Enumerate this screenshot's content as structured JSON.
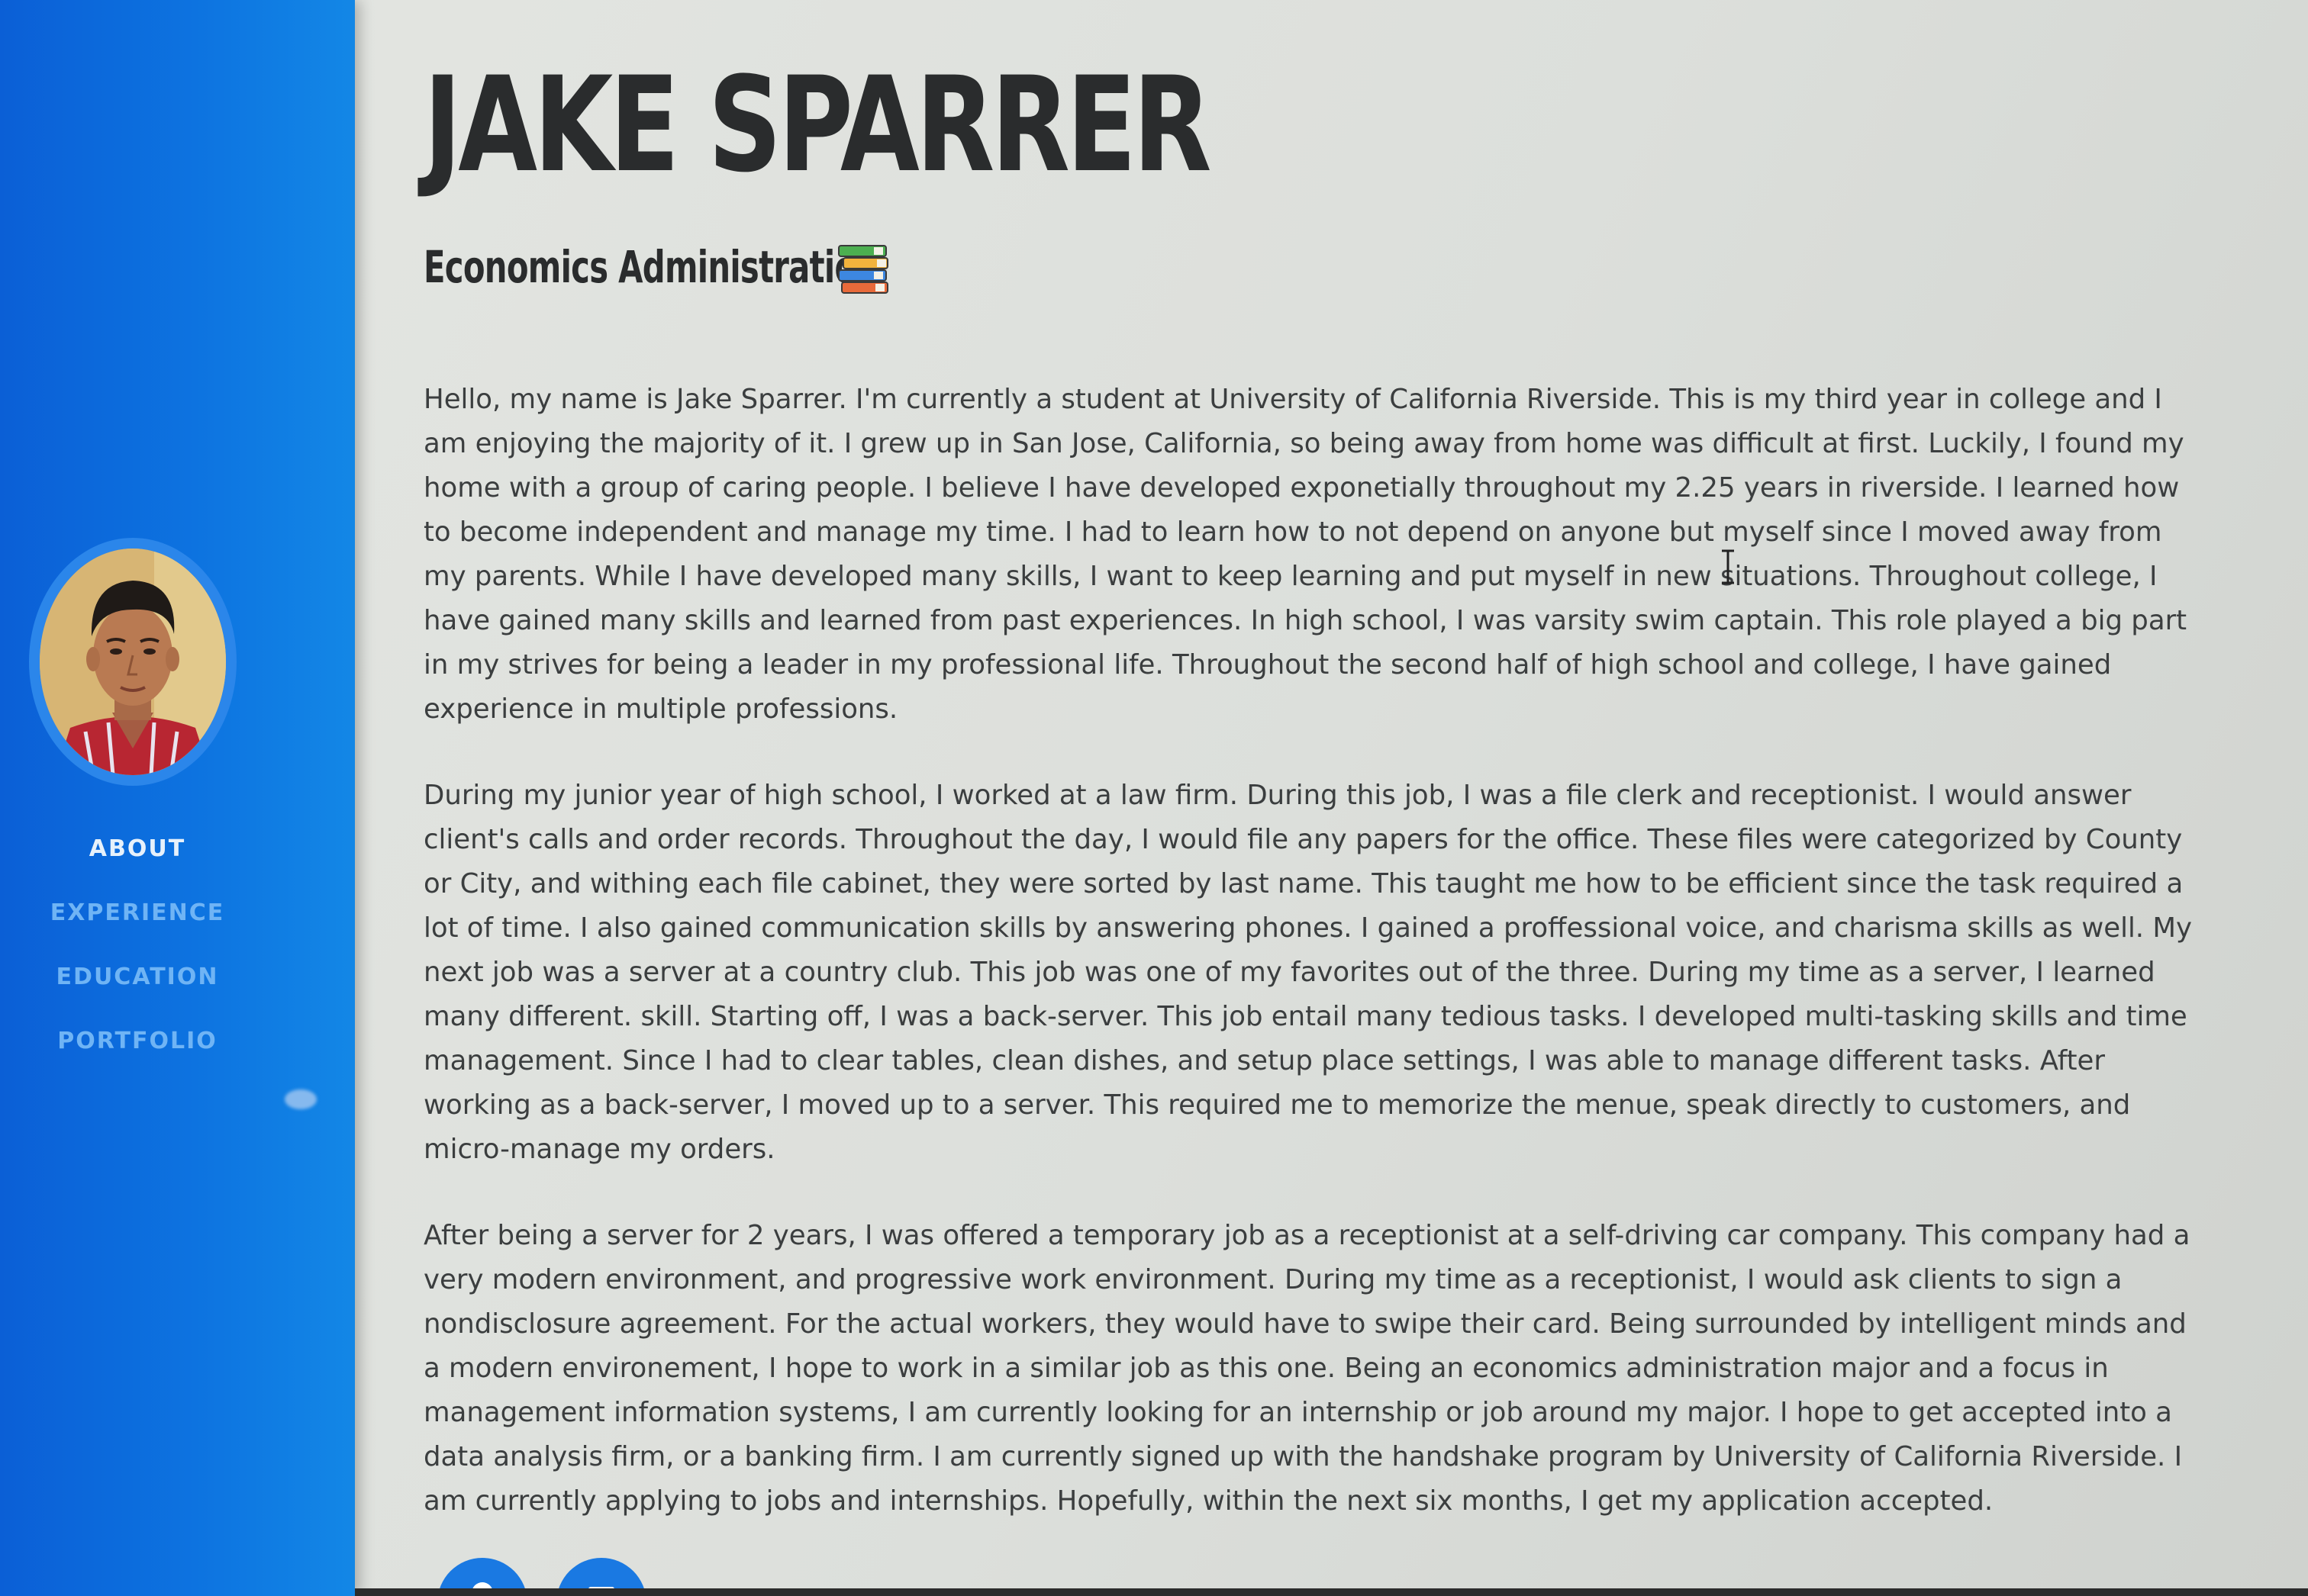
{
  "sidebar": {
    "avatar_alt": "Profile photo",
    "nav": [
      "ABOUT",
      "EXPERIENCE",
      "EDUCATION",
      "PORTFOLIO"
    ],
    "active_item": "ABOUT"
  },
  "header": {
    "name": "JAKE SPARRER",
    "subtitle": "Economics Administration",
    "subtitle_icon": "books-icon"
  },
  "about": {
    "paragraphs": [
      "Hello, my name is Jake Sparrer. I'm currently a student at University of California Riverside. This is my third year in college and I am enjoying the majority of it. I grew up in San Jose, California, so being away from home was difficult at first. Luckily, I found my home with a group of caring people. I believe I have developed exponetially throughout my 2.25 years in riverside. I learned how to become independent and manage my time. I had to learn how to not depend on anyone but myself since I moved away from my parents. While I have developed many skills, I want to keep learning and put myself in new situations. Throughout college, I have gained many skills and learned from past experiences. In high school, I was varsity swim captain. This role played a big part in my strives for being a leader in my professional life. Throughout the second half of high school and college, I have gained experience in multiple professions.",
      "During my junior year of high school, I worked at a law firm. During this job, I was a file clerk and receptionist. I would answer client's calls and order records. Throughout the day, I would file any papers for the office. These files were categorized by County or City, and withing each file cabinet, they were sorted by last name. This taught me how to be efficient since the task required a lot of time. I also gained communication skills by answering phones. I gained a proffessional voice, and charisma skills as well. My next job was a server at a country club. This job was one of my favorites out of the three. During my time as a server, I learned many different. skill. Starting off, I was a back-server. This job entail many tedious tasks. I developed multi-tasking skills and time management. Since I had to clear tables, clean dishes, and setup place settings, I was able to manage different tasks. After working as a back-server, I moved up to a server. This required me to memorize the menue, speak directly to customers, and micro-manage my orders.",
      "After being a server for 2 years, I was offered a temporary job as a receptionist at a self-driving car company. This company had a very modern environment, and progressive work environment. During my time as a receptionist, I would ask clients to sign a nondisclosure agreement. For the actual workers, they would have to swipe their card. Being surrounded by intelligent minds and a modern environement, I hope to work in a similar job as this one. Being an economics administration major and a focus in management information systems, I am currently looking for an internship or job around my major. I hope to get accepted into a data analysis firm, or a banking firm. I am currently signed up with the handshake program by University of California Riverside. I am currently applying to jobs and internships. Hopefully, within the next six months, I get my application accepted."
    ]
  },
  "social": [
    {
      "icon": "social-icon-1"
    },
    {
      "icon": "social-icon-2"
    }
  ],
  "colors": {
    "sidebar_blue": "#0d73e0",
    "nav_active": "#e7f1fb",
    "nav_inactive": "#6fb4f5",
    "heading": "#2a2c2d",
    "body_text": "#3b3e3f",
    "background": "#dcdfdb"
  }
}
